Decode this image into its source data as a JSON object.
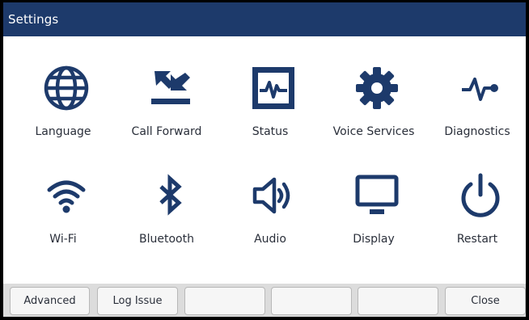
{
  "window": {
    "title": "Settings"
  },
  "colors": {
    "header_bg": "#1d3a6b",
    "icon": "#1d3a6b",
    "softkey_bar": "#dcdcdc"
  },
  "tiles": [
    {
      "label": "Language",
      "icon": "globe-icon"
    },
    {
      "label": "Call Forward",
      "icon": "call-forward-icon"
    },
    {
      "label": "Status",
      "icon": "status-monitor-icon"
    },
    {
      "label": "Voice Services",
      "icon": "gear-icon"
    },
    {
      "label": "Diagnostics",
      "icon": "pulse-icon"
    },
    {
      "label": "Wi-Fi",
      "icon": "wifi-icon"
    },
    {
      "label": "Bluetooth",
      "icon": "bluetooth-icon"
    },
    {
      "label": "Audio",
      "icon": "speaker-icon"
    },
    {
      "label": "Display",
      "icon": "monitor-icon"
    },
    {
      "label": "Restart",
      "icon": "power-icon"
    }
  ],
  "softkeys": [
    {
      "label": "Advanced"
    },
    {
      "label": "Log Issue"
    },
    {
      "label": ""
    },
    {
      "label": ""
    },
    {
      "label": ""
    },
    {
      "label": "Close"
    }
  ]
}
